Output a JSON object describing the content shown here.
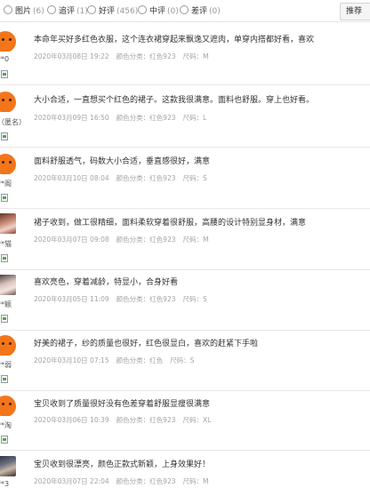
{
  "filters": [
    {
      "label": "图片",
      "count": "(6)"
    },
    {
      "label": "追评",
      "count": "(1)"
    },
    {
      "label": "好评",
      "count": "(456)"
    },
    {
      "label": "中评",
      "count": "(0)"
    },
    {
      "label": "差评",
      "count": "(0)"
    }
  ],
  "sort_label": "推荐",
  "reviews": [
    {
      "username": "**0",
      "text": "本命年买好多红色衣服，这个连衣裙穿起来飘逸又遮肉，单穿内搭都好看，喜欢",
      "date": "2020年03月08日 19:22",
      "color": "颜色分类：红色923",
      "size": "尺码：M"
    },
    {
      "username": "（匿名）",
      "text": "大小合适，一直想买个红色的裙子。这款我很满意。面料也舒服。穿上也好看。",
      "date": "2020年03月09日 16:50",
      "color": "颜色分类：红色923",
      "size": "尺码：L"
    },
    {
      "username": "**阁",
      "text": "面料舒服透气，码数大小合适，垂直感很好，满意",
      "date": "2020年03月10日 08:04",
      "color": "颜色分类：红色923",
      "size": "尺码：S"
    },
    {
      "username": "**猫",
      "text": "裙子收到，做工很精细，面料柔软穿着很舒服，高腰的设计特别显身材，满意",
      "date": "2020年03月07日 09:08",
      "color": "颜色分类：红色923",
      "size": "尺码：M"
    },
    {
      "username": "**颖",
      "text": "喜欢亮色，穿着减龄，特显小，合身好看",
      "date": "2020年03月05日 11:09",
      "color": "颜色分类：红色923",
      "size": "尺码：S"
    },
    {
      "username": "**弱",
      "text": "好美的裙子，纱的质量也很好，红色很显白，喜欢的赶紧下手啦",
      "date": "2020年03月10日 07:15",
      "color": "颜色分类：红色",
      "size": "尺码：S"
    },
    {
      "username": "**淘",
      "text": "宝贝收到了质量很好没有色差穿着舒服显瘦很满意",
      "date": "2020年03月06日 10:39",
      "color": "颜色分类：红色923",
      "size": "尺码：XL"
    },
    {
      "username": "**3",
      "text": "宝贝收到很漂亮，颜色正款式新颖，上身效果好！",
      "date": "2020年03月07日 22:04",
      "color": "颜色分类：红色923",
      "size": "尺码：M"
    }
  ]
}
